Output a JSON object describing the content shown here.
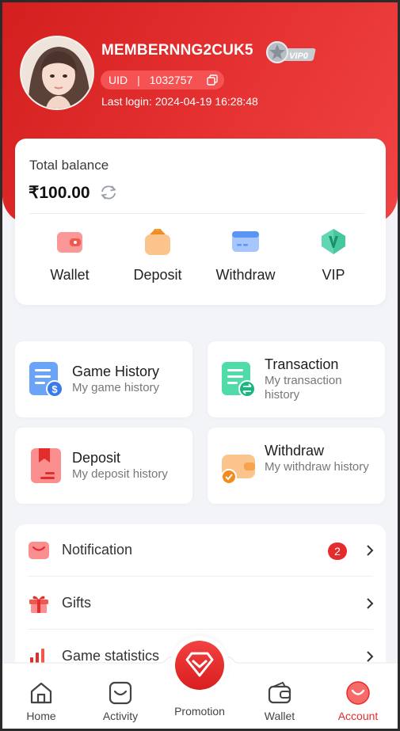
{
  "profile": {
    "username": "MEMBERNNG2CUK5",
    "vip_badge": "VIP0",
    "uid_label": "UID",
    "uid_separator": "|",
    "uid_value": "1032757",
    "last_login_label": "Last login:",
    "last_login_value": "2024-04-19 16:28:48"
  },
  "balance": {
    "label": "Total balance",
    "amount": "₹100.00"
  },
  "quick_actions": [
    {
      "label": "Wallet",
      "icon": "wallet-icon"
    },
    {
      "label": "Deposit",
      "icon": "deposit-icon"
    },
    {
      "label": "Withdraw",
      "icon": "withdraw-card-icon"
    },
    {
      "label": "VIP",
      "icon": "vip-gem-icon"
    }
  ],
  "history_tiles": [
    {
      "title": "Game History",
      "subtitle": "My game history",
      "icon": "game-history-icon"
    },
    {
      "title": "Transaction",
      "subtitle": "My transaction history",
      "icon": "transaction-icon"
    },
    {
      "title": "Deposit",
      "subtitle": "My deposit history",
      "icon": "deposit-history-icon"
    },
    {
      "title": "Withdraw",
      "subtitle": "My withdraw history",
      "icon": "withdraw-history-icon"
    }
  ],
  "menu": [
    {
      "label": "Notification",
      "badge": "2",
      "icon": "notification-icon"
    },
    {
      "label": "Gifts",
      "icon": "gift-icon"
    },
    {
      "label": "Game statistics",
      "icon": "statistics-icon"
    }
  ],
  "nav": {
    "home": "Home",
    "activity": "Activity",
    "promotion": "Promotion",
    "wallet": "Wallet",
    "account": "Account"
  },
  "colors": {
    "brand_red": "#e52c2c",
    "background": "#f3f4f8"
  }
}
